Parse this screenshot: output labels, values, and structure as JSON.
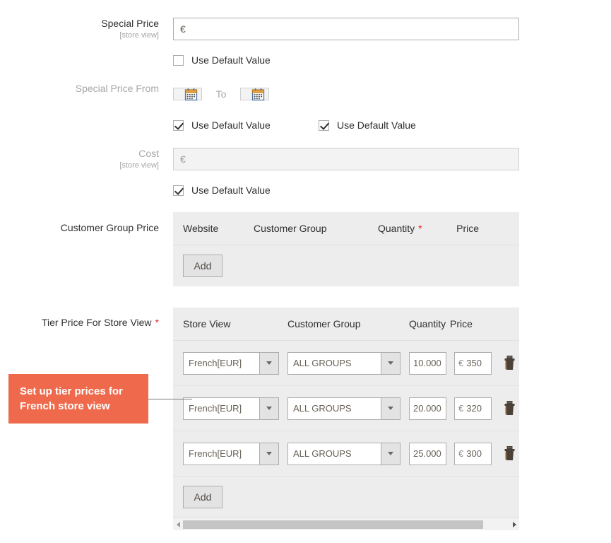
{
  "fields": {
    "special_price": {
      "label": "Special Price",
      "scope": "[store view]",
      "currency": "€",
      "value": "",
      "use_default_label": "Use Default Value",
      "use_default_checked": false
    },
    "special_price_from": {
      "label": "Special Price From",
      "to_label": "To",
      "from_value": "",
      "to_value": "",
      "from_use_default_label": "Use Default Value",
      "to_use_default_label": "Use Default Value",
      "from_use_default_checked": true,
      "to_use_default_checked": true
    },
    "cost": {
      "label": "Cost",
      "scope": "[store view]",
      "currency": "€",
      "value": "",
      "use_default_label": "Use Default Value",
      "use_default_checked": true
    }
  },
  "customer_group_price": {
    "label": "Customer Group Price",
    "headers": [
      "Website",
      "Customer Group",
      "Quantity",
      "Price"
    ],
    "quantity_required": "*",
    "rows": [],
    "add_label": "Add"
  },
  "tier_price": {
    "label": "Tier Price For Store View",
    "required": "*",
    "headers": [
      "Store View",
      "Customer Group",
      "Quantity",
      "Price"
    ],
    "currency": "€",
    "rows": [
      {
        "store_view": "French[EUR]",
        "customer_group": "ALL GROUPS",
        "quantity": "10.000",
        "price": "350"
      },
      {
        "store_view": "French[EUR]",
        "customer_group": "ALL GROUPS",
        "quantity": "20.000",
        "price": "320"
      },
      {
        "store_view": "French[EUR]",
        "customer_group": "ALL GROUPS",
        "quantity": "25.000",
        "price": "300"
      }
    ],
    "add_label": "Add"
  },
  "callout": {
    "text": "Set up tier prices for French store view",
    "color": "#ef6a4c",
    "text_color": "#ffffff"
  },
  "colors": {
    "accent": "#ef6a4c",
    "required": "#e22626",
    "table_bg": "#ededed",
    "muted_label": "#a6a6a6"
  }
}
